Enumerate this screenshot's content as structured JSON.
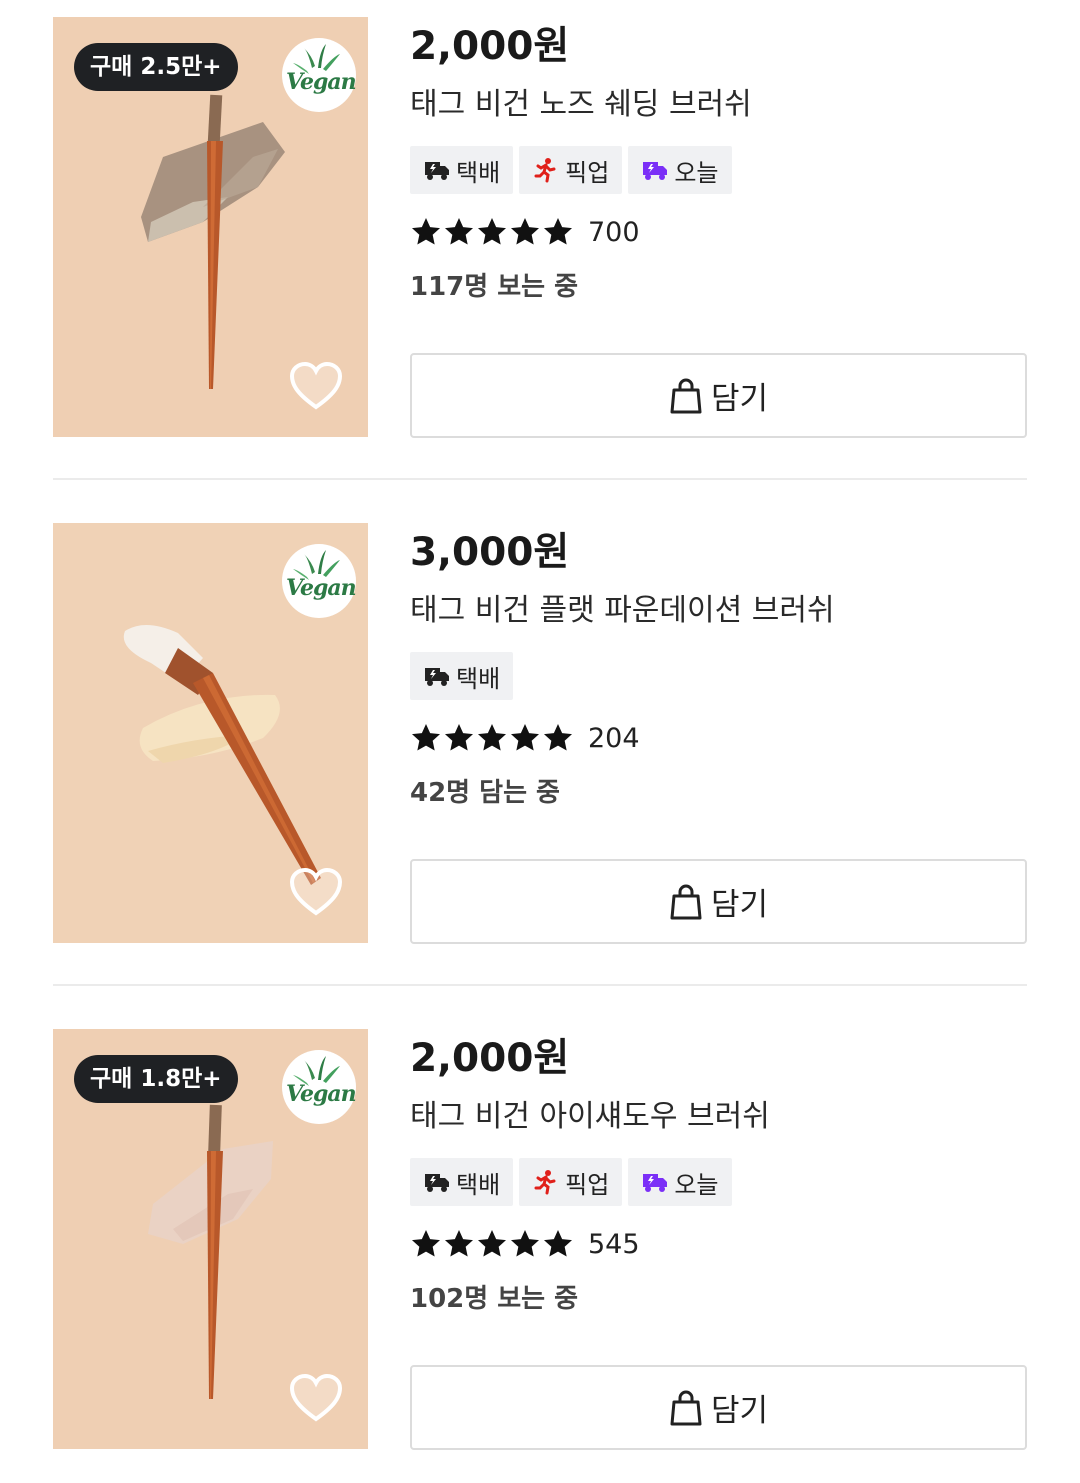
{
  "products": [
    {
      "sold_badge": "구매 2.5만+",
      "vegan_mark": "Vegan",
      "price": "2,000원",
      "name": "태그 비건 노즈 쉐딩 브러쉬",
      "delivery_tags": [
        {
          "label": "택배",
          "icon": "delivery-truck-icon"
        },
        {
          "label": "픽업",
          "icon": "pickup-runner-icon"
        },
        {
          "label": "오늘",
          "icon": "today-delivery-icon"
        }
      ],
      "rating_stars": 5,
      "review_count": "700",
      "activity": "117명 보는 중",
      "cart_label": "담기"
    },
    {
      "sold_badge": "",
      "vegan_mark": "Vegan",
      "price": "3,000원",
      "name": "태그 비건 플랫 파운데이션 브러쉬",
      "delivery_tags": [
        {
          "label": "택배",
          "icon": "delivery-truck-icon"
        }
      ],
      "rating_stars": 5,
      "review_count": "204",
      "activity": "42명 담는 중",
      "cart_label": "담기"
    },
    {
      "sold_badge": "구매 1.8만+",
      "vegan_mark": "Vegan",
      "price": "2,000원",
      "name": "태그 비건 아이섀도우 브러쉬",
      "delivery_tags": [
        {
          "label": "택배",
          "icon": "delivery-truck-icon"
        },
        {
          "label": "픽업",
          "icon": "pickup-runner-icon"
        },
        {
          "label": "오늘",
          "icon": "today-delivery-icon"
        }
      ],
      "rating_stars": 5,
      "review_count": "545",
      "activity": "102명 보는 중",
      "cart_label": "담기"
    }
  ],
  "colors": {
    "pickup_icon": "#e0201a",
    "today_icon": "#7b2ff7",
    "delivery_icon": "#222222",
    "badge_bg": "#1f2124",
    "tag_bg": "#f0f1f3",
    "vegan_green": "#2c7a45",
    "thumb_bg": "#efcfb3"
  }
}
